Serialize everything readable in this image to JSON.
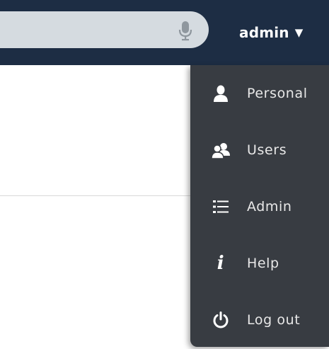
{
  "header": {
    "user_menu": {
      "username": "admin",
      "caret": "▼"
    },
    "search": {
      "icon": "microphone-icon"
    }
  },
  "user_menu": {
    "items": [
      {
        "label": "Personal",
        "icon": "person-icon"
      },
      {
        "label": "Users",
        "icon": "users-icon"
      },
      {
        "label": "Admin",
        "icon": "list-icon"
      },
      {
        "label": "Help",
        "icon": "info-icon",
        "glyph": "i"
      },
      {
        "label": "Log out",
        "icon": "power-icon"
      }
    ]
  },
  "colors": {
    "header_bg": "#1d2d44",
    "menu_bg": "#383c42",
    "search_bg": "#d5dbe0",
    "menu_text": "#e8e8e8"
  }
}
